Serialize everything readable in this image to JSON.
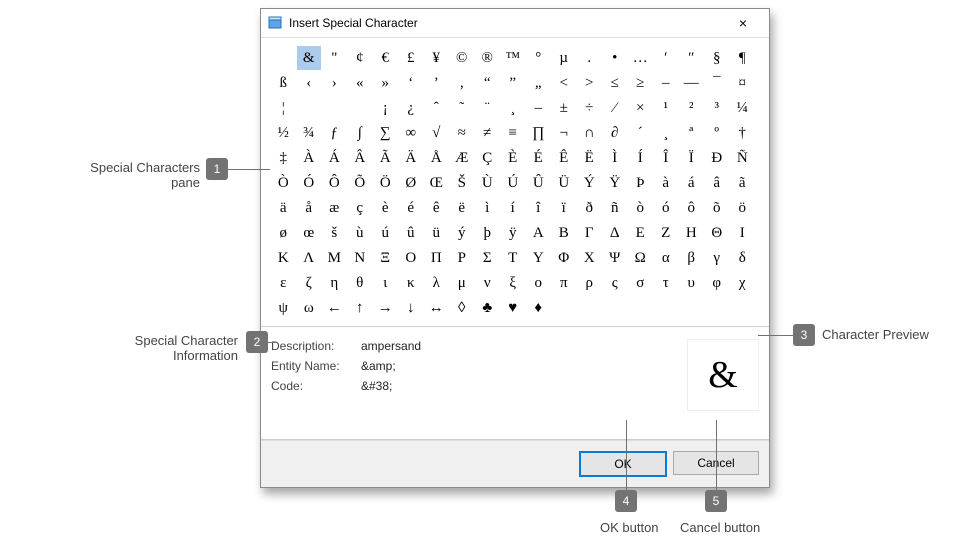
{
  "dialog": {
    "title": "Insert Special Character",
    "close_label": "×",
    "ok_label": "OK",
    "cancel_label": "Cancel"
  },
  "characters": [
    "",
    "&",
    "\"",
    "¢",
    "€",
    "£",
    "¥",
    "©",
    "®",
    "™",
    "°",
    "µ",
    ".",
    "•",
    "…",
    "′",
    "″",
    "§",
    "¶",
    "ß",
    "‹",
    "›",
    "«",
    "»",
    "‘",
    "’",
    "‚",
    "“",
    "”",
    "„",
    "<",
    ">",
    "≤",
    "≥",
    "–",
    "—",
    "¯",
    "¤",
    "¦",
    "",
    "",
    "",
    "¡",
    "¿",
    "ˆ",
    "˜",
    "¨",
    "¸",
    "–",
    "±",
    "÷",
    "⁄",
    "×",
    "¹",
    "²",
    "³",
    "¼",
    "½",
    "¾",
    "ƒ",
    "∫",
    "∑",
    "∞",
    "√",
    "≈",
    "≠",
    "≡",
    "∏",
    "¬",
    "∩",
    "∂",
    "´",
    "¸",
    "ª",
    "º",
    "†",
    "‡",
    "À",
    "Á",
    "Â",
    "Ã",
    "Ä",
    "Å",
    "Æ",
    "Ç",
    "È",
    "É",
    "Ê",
    "Ë",
    "Ì",
    "Í",
    "Î",
    "Ï",
    "Ð",
    "Ñ",
    "Ò",
    "Ó",
    "Ô",
    "Õ",
    "Ö",
    "Ø",
    "Œ",
    "Š",
    "Ù",
    "Ú",
    "Û",
    "Ü",
    "Ý",
    "Ÿ",
    "Þ",
    "à",
    "á",
    "â",
    "ã",
    "ä",
    "å",
    "æ",
    "ç",
    "è",
    "é",
    "ê",
    "ë",
    "ì",
    "í",
    "î",
    "ï",
    "ð",
    "ñ",
    "ò",
    "ó",
    "ô",
    "õ",
    "ö",
    "ø",
    "œ",
    "š",
    "ù",
    "ú",
    "û",
    "ü",
    "ý",
    "þ",
    "ÿ",
    "Α",
    "Β",
    "Γ",
    "Δ",
    "Ε",
    "Ζ",
    "Η",
    "Θ",
    "Ι",
    "Κ",
    "Λ",
    "Μ",
    "Ν",
    "Ξ",
    "Ο",
    "Π",
    "Ρ",
    "Σ",
    "Τ",
    "Υ",
    "Φ",
    "Χ",
    "Ψ",
    "Ω",
    "α",
    "β",
    "γ",
    "δ",
    "ε",
    "ζ",
    "η",
    "θ",
    "ι",
    "κ",
    "λ",
    "μ",
    "ν",
    "ξ",
    "ο",
    "π",
    "ρ",
    "ς",
    "σ",
    "τ",
    "υ",
    "φ",
    "χ",
    "ψ",
    "ω",
    "←",
    "↑",
    "→",
    "↓",
    "↔",
    "◊",
    "♣",
    "♥",
    "♦"
  ],
  "selected_index": 1,
  "info": {
    "desc_label": "Description:",
    "desc_value": "ampersand",
    "entity_label": "Entity Name:",
    "entity_value": "&amp;",
    "code_label": "Code:",
    "code_value": "&#38;"
  },
  "preview_char": "&",
  "callouts": {
    "c1_num": "1",
    "c1_label": "Special Characters pane",
    "c2_num": "2",
    "c2_label": "Special Character Information",
    "c3_num": "3",
    "c3_label": "Character Preview",
    "c4_num": "4",
    "c4_label": "OK button",
    "c5_num": "5",
    "c5_label": "Cancel button"
  }
}
